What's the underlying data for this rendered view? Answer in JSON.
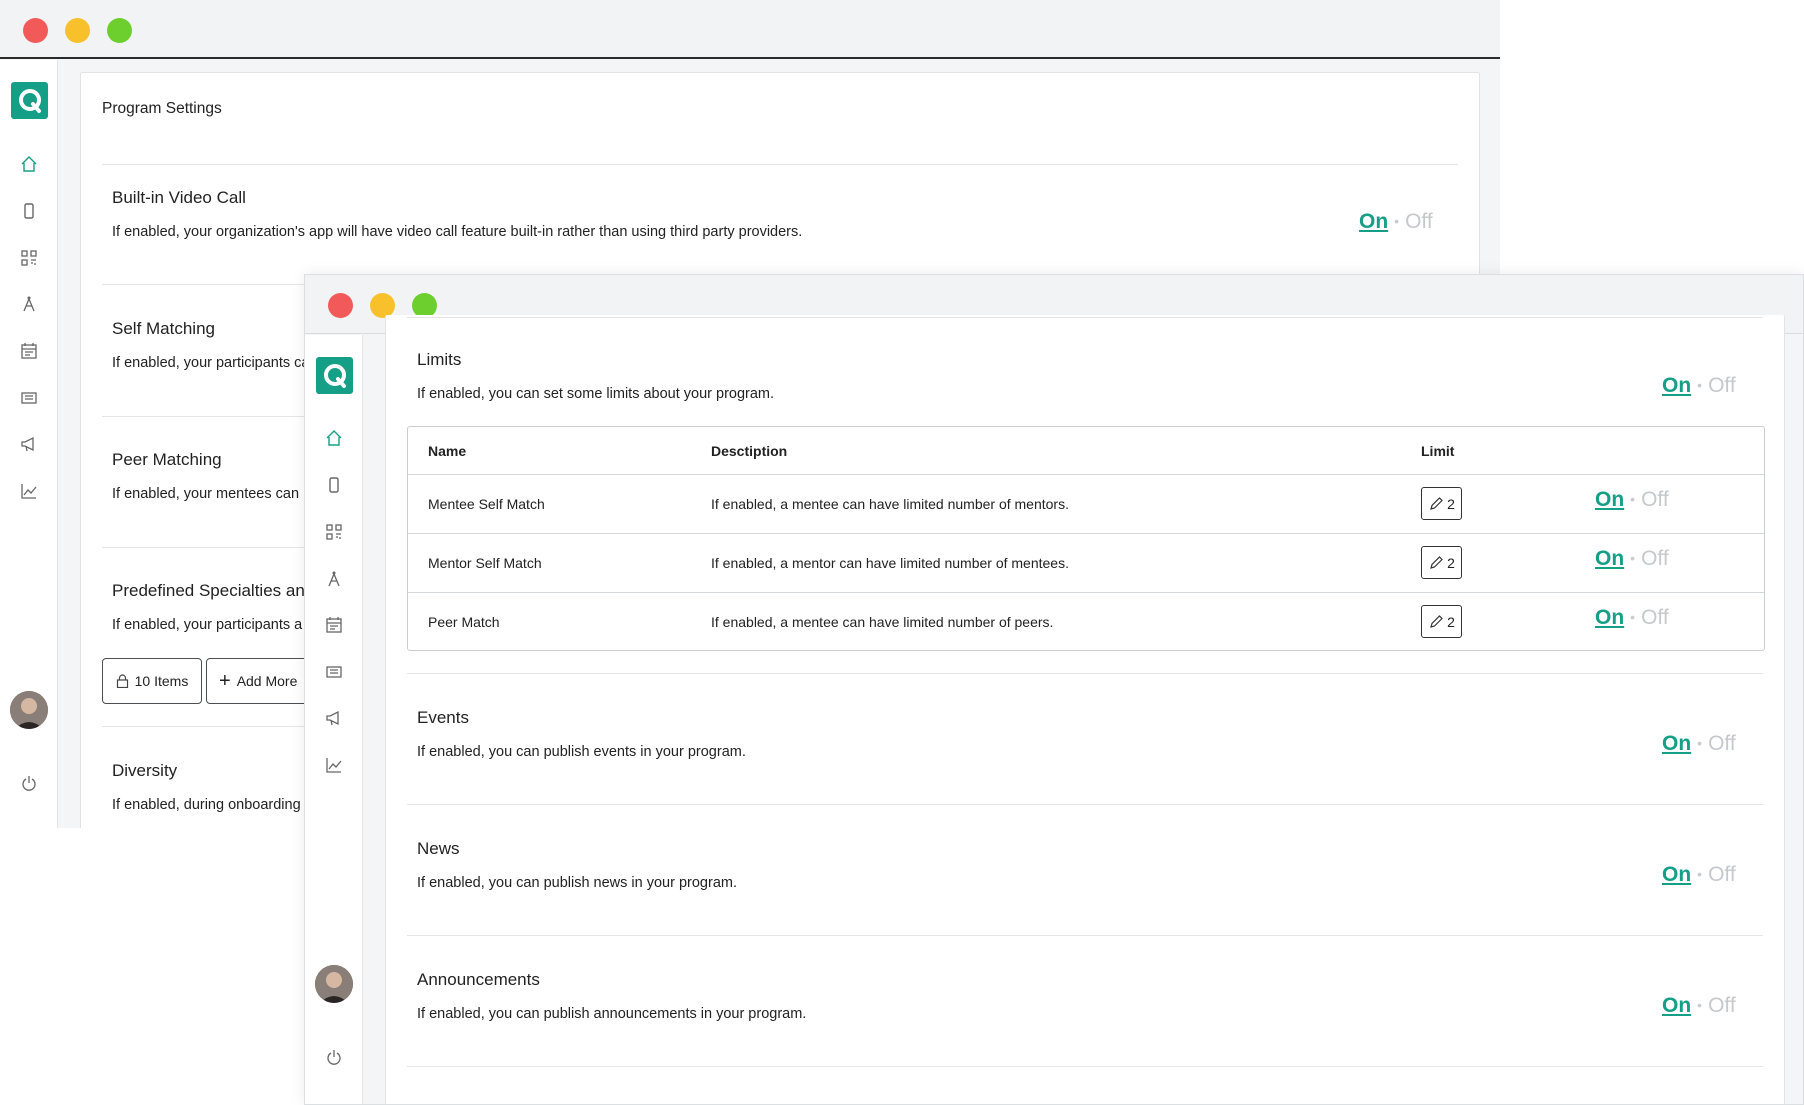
{
  "back_window": {
    "page_title": "Program Settings",
    "sections": [
      {
        "title": "Built-in Video Call",
        "desc": "If enabled, your organization's app will have video call feature built-in rather than using third party providers."
      },
      {
        "title": "Self Matching",
        "desc": "If enabled, your participants ca"
      },
      {
        "title": "Peer Matching",
        "desc": "If enabled, your mentees can"
      },
      {
        "title": "Predefined Specialties and",
        "desc": "If enabled, your participants a"
      },
      {
        "title": "Diversity",
        "desc": "If enabled, during onboarding"
      }
    ],
    "items_chip": "10 Items",
    "add_more": "Add More",
    "toggle": {
      "on": "On",
      "sep": "•",
      "off": "Off"
    }
  },
  "front_window": {
    "limits": {
      "title": "Limits",
      "desc": "If enabled, you can set some limits about your program.",
      "table": {
        "headers": [
          "Name",
          "Desctiption",
          "Limit"
        ],
        "rows": [
          {
            "name": "Mentee Self Match",
            "desc": "If enabled, a mentee can have limited number of mentors.",
            "limit": "2"
          },
          {
            "name": "Mentor Self Match",
            "desc": "If enabled, a mentor can have limited number of mentees.",
            "limit": "2"
          },
          {
            "name": "Peer Match",
            "desc": "If enabled, a mentee can have limited number of peers.",
            "limit": "2"
          }
        ]
      }
    },
    "sections": [
      {
        "title": "Events",
        "desc": "If enabled, you can publish events in your program."
      },
      {
        "title": "News",
        "desc": "If enabled, you can publish news in your program."
      },
      {
        "title": "Announcements",
        "desc": "If enabled, you can publish announcements in your program."
      }
    ]
  },
  "colors": {
    "accent": "#159f87",
    "off": "#c6c9cc",
    "red": "#f15a58",
    "yellow": "#f8c12c",
    "green": "#6ccf2e"
  },
  "nav_icons": [
    "home-icon",
    "mobile-icon",
    "qr-scan-icon",
    "compass-icon",
    "calendar-icon",
    "news-icon",
    "megaphone-icon",
    "chart-icon"
  ]
}
